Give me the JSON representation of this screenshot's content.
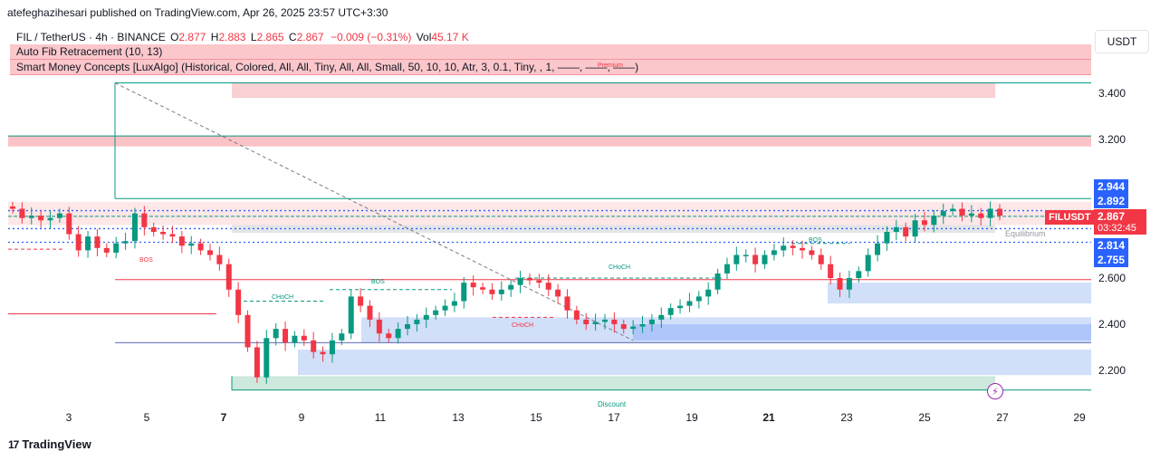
{
  "header": {
    "publisher_line": "atefeghazihesari published on TradingView.com, Apr 26, 2025 23:57 UTC+3:30"
  },
  "legend": {
    "symbol_line": "FIL / TetherUS · 4h · BINANCE",
    "ohlc": {
      "o_label": "O",
      "o": "2.877",
      "h_label": "H",
      "h": "2.883",
      "l_label": "L",
      "l": "2.865",
      "c_label": "C",
      "c": "2.867",
      "change": "−0.009 (−0.31%)",
      "vol_label": "Vol",
      "vol": "45.17 K"
    },
    "indicator_1": "Auto Fib Retracement (10, 13)",
    "indicator_2": "Smart Money Concepts [LuxAlgo] (Historical, Colored, All, All, Tiny, All, All, Small, 50, 10, 10, Atr, 3, 0.1, Tiny, , 1, ——, ——, ——)"
  },
  "axis": {
    "currency_button": "USDT",
    "ticks": [
      "3.400",
      "3.200",
      "2.600",
      "2.400",
      "2.200"
    ],
    "price_labels": [
      {
        "text": "2.944",
        "color": "#2962ff"
      },
      {
        "text": "2.892",
        "color": "#2962ff"
      },
      {
        "text": "2.814",
        "color": "#2962ff"
      },
      {
        "text": "2.755",
        "color": "#2962ff"
      }
    ],
    "current_price": "2.867",
    "countdown": "03:32:45",
    "symbol_tag": "FILUSDT"
  },
  "x_axis": {
    "ticks": [
      "3",
      "5",
      "7",
      "9",
      "11",
      "13",
      "15",
      "17",
      "19",
      "21",
      "23",
      "25",
      "27",
      "29"
    ]
  },
  "annotations": {
    "premium": "Premium",
    "equilibrium": "Equilibrium",
    "discount": "Discount",
    "bos": "BOS",
    "choch": "CHoCH"
  },
  "footer": {
    "brand": "TradingView",
    "logo": "17"
  },
  "colors": {
    "up": "#089981",
    "down": "#f23645",
    "blue_accent": "#2962ff",
    "premium_zone": "#f7c5c8",
    "discount_zone": "#c8e6d9",
    "demand_zone": "#c5d7f7"
  },
  "chart_data": {
    "type": "candlestick",
    "title": "FIL / TetherUS · 4h · BINANCE",
    "ylim": [
      2.1,
      3.45
    ],
    "x_ticks": [
      "3",
      "5",
      "7",
      "9",
      "11",
      "13",
      "15",
      "17",
      "19",
      "21",
      "23",
      "25",
      "27",
      "29"
    ],
    "y_ticks": [
      3.4,
      3.2,
      2.6,
      2.4,
      2.2
    ],
    "series": [
      {
        "name": "FILUSDT",
        "closes": [
          2.9,
          2.86,
          2.87,
          2.85,
          2.86,
          2.88,
          2.79,
          2.72,
          2.78,
          2.73,
          2.71,
          2.75,
          2.76,
          2.88,
          2.82,
          2.8,
          2.79,
          2.78,
          2.74,
          2.75,
          2.72,
          2.7,
          2.66,
          2.55,
          2.44,
          2.3,
          2.17,
          2.34,
          2.38,
          2.32,
          2.35,
          2.33,
          2.28,
          2.27,
          2.33,
          2.36,
          2.52,
          2.48,
          2.42,
          2.36,
          2.34,
          2.38,
          2.4,
          2.42,
          2.44,
          2.46,
          2.48,
          2.5,
          2.58,
          2.56,
          2.55,
          2.53,
          2.55,
          2.57,
          2.6,
          2.59,
          2.58,
          2.55,
          2.52,
          2.46,
          2.42,
          2.4,
          2.41,
          2.42,
          2.4,
          2.38,
          2.39,
          2.4,
          2.42,
          2.44,
          2.47,
          2.48,
          2.5,
          2.52,
          2.55,
          2.62,
          2.66,
          2.7,
          2.7,
          2.66,
          2.7,
          2.72,
          2.74,
          2.73,
          2.72,
          2.7,
          2.66,
          2.6,
          2.55,
          2.6,
          2.63,
          2.7,
          2.75,
          2.8,
          2.82,
          2.78,
          2.85,
          2.83,
          2.87,
          2.89,
          2.9,
          2.87,
          2.88,
          2.86,
          2.9,
          2.87
        ]
      }
    ],
    "levels": {
      "fib_high": 3.445,
      "fib_low": 2.115,
      "equilibrium": 2.814,
      "current": 2.867
    },
    "grid": false,
    "legend": "top-left"
  }
}
